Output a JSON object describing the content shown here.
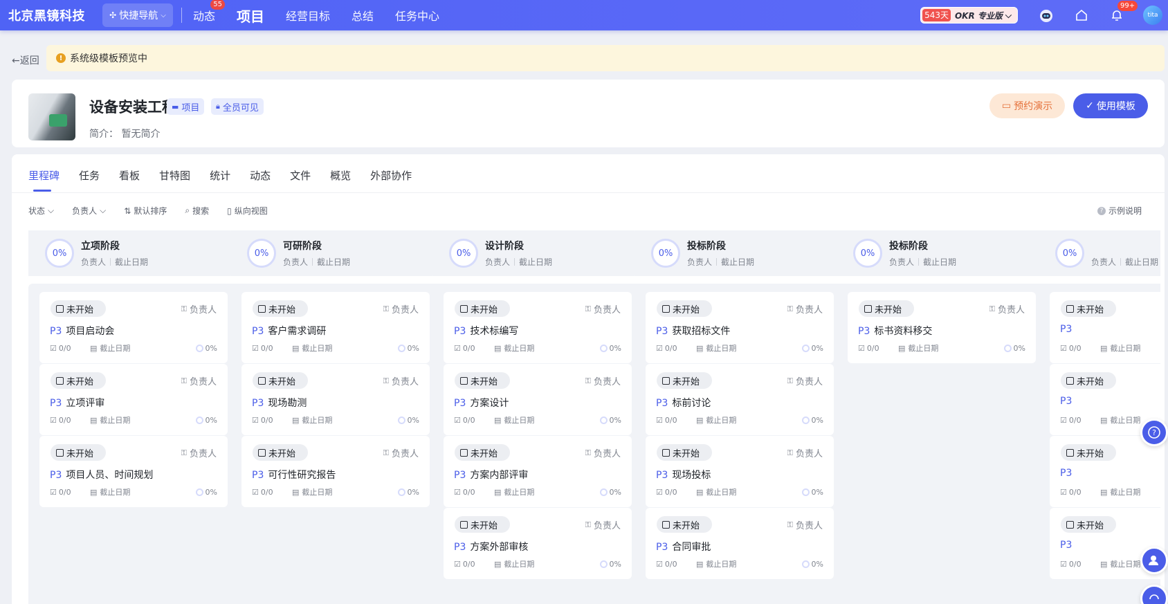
{
  "topbar": {
    "brand": "北京黑镜科技",
    "quicknav_label": "快捷导航",
    "nav": [
      {
        "label": "动态",
        "badge": "55"
      },
      {
        "label": "项目",
        "badge": ""
      },
      {
        "label": "经营目标",
        "badge": ""
      },
      {
        "label": "总结",
        "badge": ""
      },
      {
        "label": "任务中心",
        "badge": ""
      }
    ],
    "okr_days": "543天",
    "okr_label": "OKR 专业版",
    "notification_count": "99+",
    "avatar_text": "tita"
  },
  "back_label": "←返回",
  "notice_text": "系统级模板预览中",
  "project": {
    "title": "设备安装工程",
    "tag_type": "项目",
    "tag_visibility": "全员可见",
    "description": "简介：  暂无简介",
    "btn_demo": "预约演示",
    "btn_use": "使用模板"
  },
  "tabs": [
    "里程碑",
    "任务",
    "看板",
    "甘特图",
    "统计",
    "动态",
    "文件",
    "概览",
    "外部协作"
  ],
  "toolbar": {
    "status": "状态",
    "owner": "负责人",
    "sort": "默认排序",
    "search": "搜索",
    "view": "纵向视图",
    "help": "示例说明"
  },
  "stage_meta_owner": "负责人",
  "stage_meta_due": "截止日期",
  "card_labels": {
    "status": "未开始",
    "owner": "负责人",
    "priority": "P3",
    "subtasks": "0/0",
    "due": "截止日期",
    "progress": "0%"
  },
  "stages": [
    {
      "name": "立项阶段",
      "progress": "0%",
      "tasks": [
        "项目启动会",
        "立项评审",
        "项目人员、时间规划"
      ]
    },
    {
      "name": "可研阶段",
      "progress": "0%",
      "tasks": [
        "客户需求调研",
        "现场勘测",
        "可行性研究报告"
      ]
    },
    {
      "name": "设计阶段",
      "progress": "0%",
      "tasks": [
        "技术标编写",
        "方案设计",
        "方案内部评审",
        "方案外部审核"
      ]
    },
    {
      "name": "投标阶段",
      "progress": "0%",
      "tasks": [
        "获取招标文件",
        "标前讨论",
        "现场投标",
        "合同审批"
      ]
    },
    {
      "name": "投标阶段",
      "progress": "0%",
      "tasks": [
        "标书资料移交"
      ]
    },
    {
      "name": "",
      "progress": "0%",
      "tasks": [
        "",
        "",
        "",
        ""
      ]
    }
  ],
  "colors": {
    "primary": "#4a5de8",
    "topbar": "#5464f6",
    "notice_bg": "#fdf6dd",
    "demo_bg": "#fde8d6"
  }
}
